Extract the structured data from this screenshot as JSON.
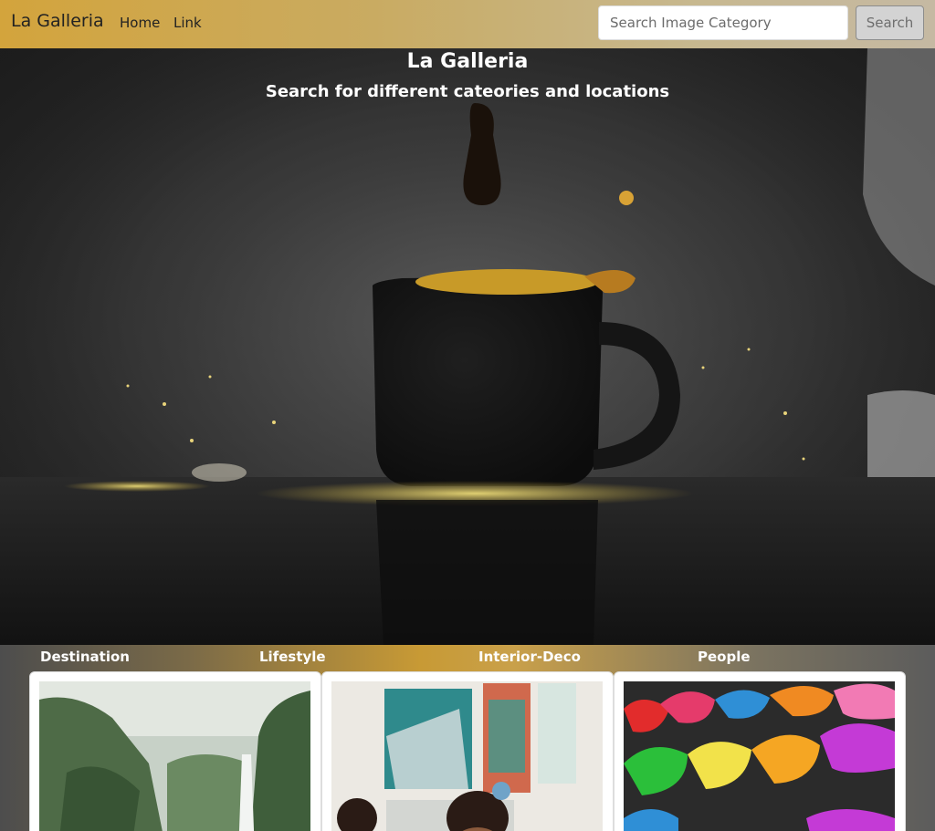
{
  "navbar": {
    "brand": "La Galleria",
    "links": [
      {
        "label": "Home"
      },
      {
        "label": "Link"
      }
    ],
    "search_placeholder": "Search Image Category",
    "search_button": "Search"
  },
  "hero": {
    "title": "La Galleria",
    "subtitle": "Search for different cateories and locations"
  },
  "categories": {
    "labels": [
      "Destination",
      "Lifestyle",
      "Interior-Deco",
      "People"
    ]
  }
}
